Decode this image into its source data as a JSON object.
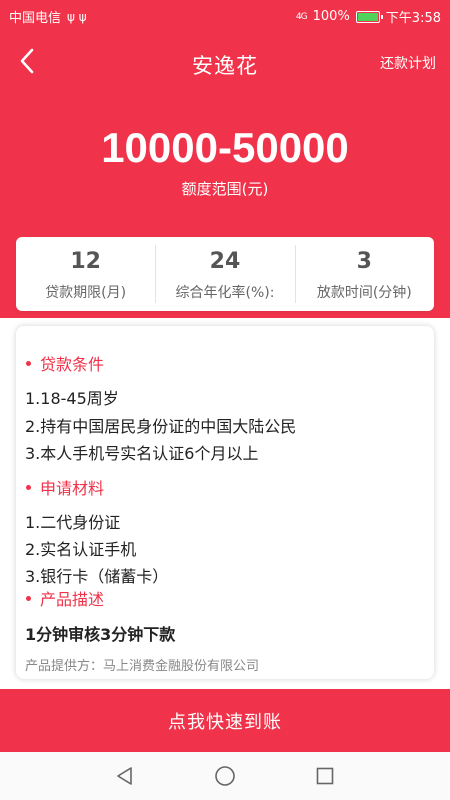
{
  "status_bar": {
    "carrier": "中国电信",
    "usb_icons": "ψ ψ",
    "network": "4G",
    "battery": "100%",
    "time": "下午3:58"
  },
  "nav": {
    "title": "安逸花",
    "right_action": "还款计划"
  },
  "hero": {
    "amount": "10000-50000",
    "amount_label": "额度范围(元)"
  },
  "stats": [
    {
      "value": "12",
      "label": "贷款期限(月)"
    },
    {
      "value": "24",
      "label": "综合年化率(%):"
    },
    {
      "value": "3",
      "label": "放款时间(分钟)"
    }
  ],
  "sections": {
    "conditions": {
      "title": "贷款条件",
      "items": [
        "1.18-45周岁",
        "2.持有中国居民身份证的中国大陆公民",
        "3.本人手机号实名认证6个月以上"
      ]
    },
    "materials": {
      "title": "申请材料",
      "items": [
        "1.二代身份证",
        "2.实名认证手机",
        "3.银行卡（储蓄卡）"
      ]
    },
    "description": {
      "title": "产品描述",
      "text": "1分钟审核3分钟下款",
      "provider": "产品提供方：马上消费金融股份有限公司"
    }
  },
  "cta": {
    "label": "点我快速到账"
  },
  "colors": {
    "brand_red": "#f0334a",
    "battery_green": "#4fd35a"
  },
  "icons": [
    "back-arrow-icon",
    "battery-icon",
    "usb-icon",
    "signal-icon",
    "nav-back-icon",
    "nav-home-icon",
    "nav-recents-icon"
  ]
}
